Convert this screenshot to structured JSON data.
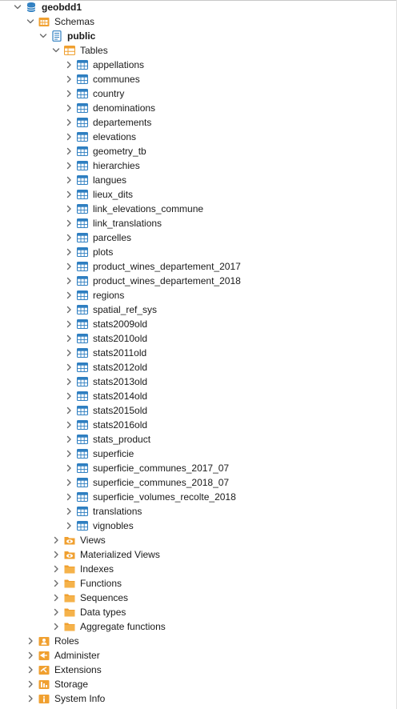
{
  "database": {
    "label": "geobdd1",
    "expanded": true,
    "icon": "database-icon"
  },
  "schemas_node": {
    "label": "Schemas",
    "expanded": true,
    "icon": "schemas-icon"
  },
  "schema": {
    "label": "public",
    "expanded": true,
    "icon": "schema-icon"
  },
  "tables_node": {
    "label": "Tables",
    "expanded": true,
    "icon": "tables-icon"
  },
  "tables": [
    "appellations",
    "communes",
    "country",
    "denominations",
    "departements",
    "elevations",
    "geometry_tb",
    "hierarchies",
    "langues",
    "lieux_dits",
    "link_elevations_commune",
    "link_translations",
    "parcelles",
    "plots",
    "product_wines_departement_2017",
    "product_wines_departement_2018",
    "regions",
    "spatial_ref_sys",
    "stats2009old",
    "stats2010old",
    "stats2011old",
    "stats2012old",
    "stats2013old",
    "stats2014old",
    "stats2015old",
    "stats2016old",
    "stats_product",
    "superficie",
    "superficie_communes_2017_07",
    "superficie_communes_2018_07",
    "superficie_volumes_recolte_2018",
    "translations",
    "vignobles"
  ],
  "schema_children": [
    {
      "label": "Views",
      "icon": "eye-folder-icon"
    },
    {
      "label": "Materialized Views",
      "icon": "eye-folder-icon"
    },
    {
      "label": "Indexes",
      "icon": "folder-icon"
    },
    {
      "label": "Functions",
      "icon": "folder-icon"
    },
    {
      "label": "Sequences",
      "icon": "folder-icon"
    },
    {
      "label": "Data types",
      "icon": "folder-icon"
    },
    {
      "label": "Aggregate functions",
      "icon": "folder-icon"
    }
  ],
  "db_children": [
    {
      "label": "Roles",
      "icon": "roles-icon"
    },
    {
      "label": "Administer",
      "icon": "administer-icon"
    },
    {
      "label": "Extensions",
      "icon": "extensions-icon"
    },
    {
      "label": "Storage",
      "icon": "storage-icon"
    },
    {
      "label": "System Info",
      "icon": "system-info-icon"
    }
  ],
  "colors": {
    "folder": "#f0a030",
    "table_icon": "#2f7fc1",
    "database": "#2f7fc1",
    "chevron": "#6b6b6b"
  }
}
